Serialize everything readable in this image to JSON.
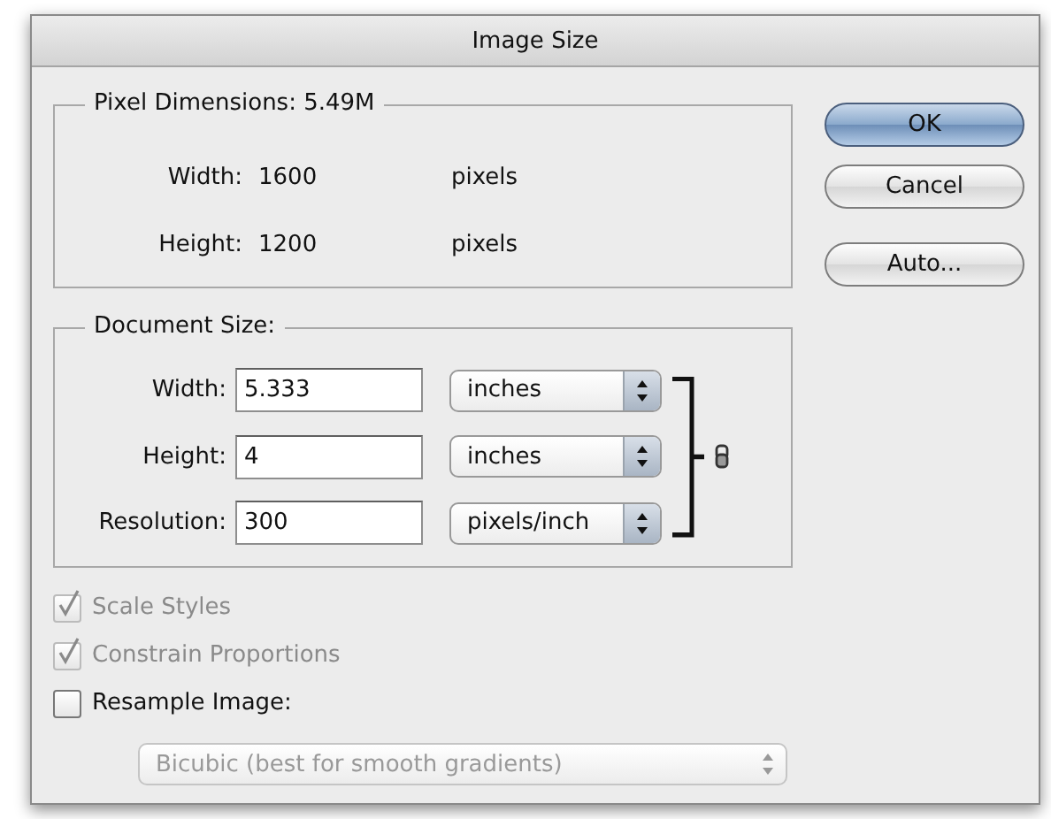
{
  "window": {
    "title": "Image Size"
  },
  "pixel_dimensions": {
    "label": "Pixel Dimensions:",
    "value": "5.49M",
    "rows": [
      {
        "label": "Width:",
        "value": "1600",
        "unit": "pixels"
      },
      {
        "label": "Height:",
        "value": "1200",
        "unit": "pixels"
      }
    ]
  },
  "document_size": {
    "label": "Document Size:",
    "linked": true,
    "rows": [
      {
        "label": "Width:",
        "value": "5.333",
        "unit": "inches"
      },
      {
        "label": "Height:",
        "value": "4",
        "unit": "inches"
      },
      {
        "label": "Resolution:",
        "value": "300",
        "unit": "pixels/inch"
      }
    ]
  },
  "options": [
    {
      "label": "Scale Styles",
      "checked": true,
      "disabled": true
    },
    {
      "label": "Constrain Proportions",
      "checked": true,
      "disabled": true
    },
    {
      "label": "Resample Image:",
      "checked": false,
      "disabled": false
    }
  ],
  "resample_method": {
    "value": "Bicubic (best for smooth gradients)",
    "disabled": true
  },
  "buttons": [
    {
      "label": "OK",
      "default": true
    },
    {
      "label": "Cancel",
      "default": false
    },
    {
      "label": "Auto...",
      "default": false
    }
  ]
}
